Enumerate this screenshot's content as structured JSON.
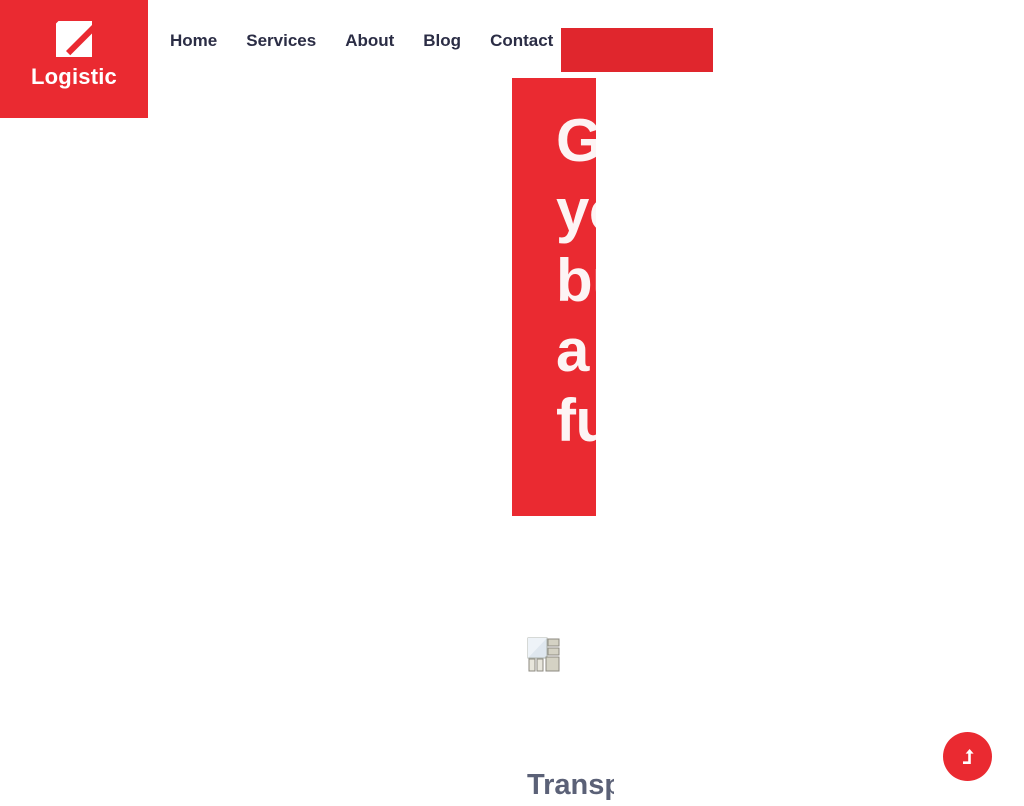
{
  "brand": {
    "name": "Logistic",
    "logo_icon": "diagonal-slash-square-logo",
    "background_color": "#ea2a31"
  },
  "header": {
    "nav_items": [
      {
        "label": "Home"
      },
      {
        "label": "Services"
      },
      {
        "label": "About"
      },
      {
        "label": "Blog"
      },
      {
        "label": "Contact"
      }
    ],
    "cta_button": {
      "label": "",
      "color": "#e0262d"
    }
  },
  "hero": {
    "heading": "Get\nyour\nbusiness\na\nfuture",
    "panel_color": "#ea2a31",
    "text_color": "#fdf4f4"
  },
  "media": {
    "placeholder_icon": "broken-image-icon",
    "alt": ""
  },
  "section": {
    "title": "Transportation",
    "title_color": "#5b6177"
  },
  "scroll_top": {
    "icon": "arrow-up-icon",
    "label": "",
    "color": "#ea2a31"
  },
  "colors": {
    "brand_red": "#ea2a31",
    "cta_red": "#e0262d",
    "nav_text": "#2b2d45",
    "heading_white": "#fdf4f4",
    "section_title": "#5b6177",
    "page_background": "#ffffff"
  }
}
